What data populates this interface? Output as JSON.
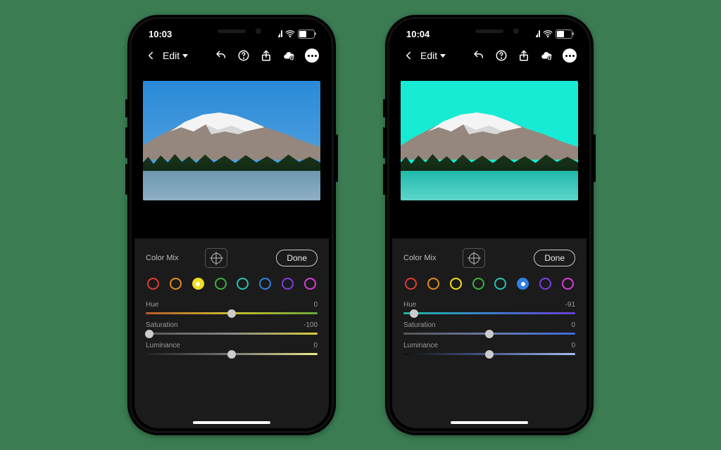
{
  "phones": [
    {
      "status_time": "10:03",
      "edit_label": "Edit",
      "panel_title": "Color Mix",
      "done_label": "Done",
      "image_variant": "blue",
      "swatches": [
        {
          "color": "#e23b2e",
          "selected": false
        },
        {
          "color": "#e38a1f",
          "selected": false
        },
        {
          "color": "#f2de22",
          "selected": true,
          "filled": true
        },
        {
          "color": "#3fae3f",
          "selected": false
        },
        {
          "color": "#28c1b0",
          "selected": false
        },
        {
          "color": "#2f7fe0",
          "selected": false
        },
        {
          "color": "#7b3fe0",
          "selected": false
        },
        {
          "color": "#d43fd4",
          "selected": false
        }
      ],
      "sliders": [
        {
          "label": "Hue",
          "value": "0",
          "pos": 50,
          "g1": "#b85a2a",
          "g2": "#c9bb2e",
          "g3": "#6aa83a"
        },
        {
          "label": "Saturation",
          "value": "-100",
          "pos": 2,
          "g1": "#555",
          "g2": "#888",
          "g3": "#d9cf3a"
        },
        {
          "label": "Luminance",
          "value": "0",
          "pos": 50,
          "g1": "#222",
          "g2": "#777",
          "g3": "#efe98a"
        }
      ]
    },
    {
      "status_time": "10:04",
      "edit_label": "Edit",
      "panel_title": "Color Mix",
      "done_label": "Done",
      "image_variant": "teal",
      "swatches": [
        {
          "color": "#e23b2e",
          "selected": false
        },
        {
          "color": "#e38a1f",
          "selected": false
        },
        {
          "color": "#f2de22",
          "selected": false
        },
        {
          "color": "#3fae3f",
          "selected": false
        },
        {
          "color": "#28c1b0",
          "selected": false
        },
        {
          "color": "#2f7fe0",
          "selected": true,
          "filled": true
        },
        {
          "color": "#7b3fe0",
          "selected": false
        },
        {
          "color": "#d43fd4",
          "selected": false
        }
      ],
      "sliders": [
        {
          "label": "Hue",
          "value": "-91",
          "pos": 6,
          "g1": "#1fb5a0",
          "g2": "#3a7fd0",
          "g3": "#6a3fd0"
        },
        {
          "label": "Saturation",
          "value": "0",
          "pos": 50,
          "g1": "#555",
          "g2": "#6a7aa8",
          "g3": "#3a6ae0"
        },
        {
          "label": "Luminance",
          "value": "0",
          "pos": 50,
          "g1": "#111",
          "g2": "#4a5a90",
          "g3": "#a8bdf0"
        }
      ]
    }
  ]
}
